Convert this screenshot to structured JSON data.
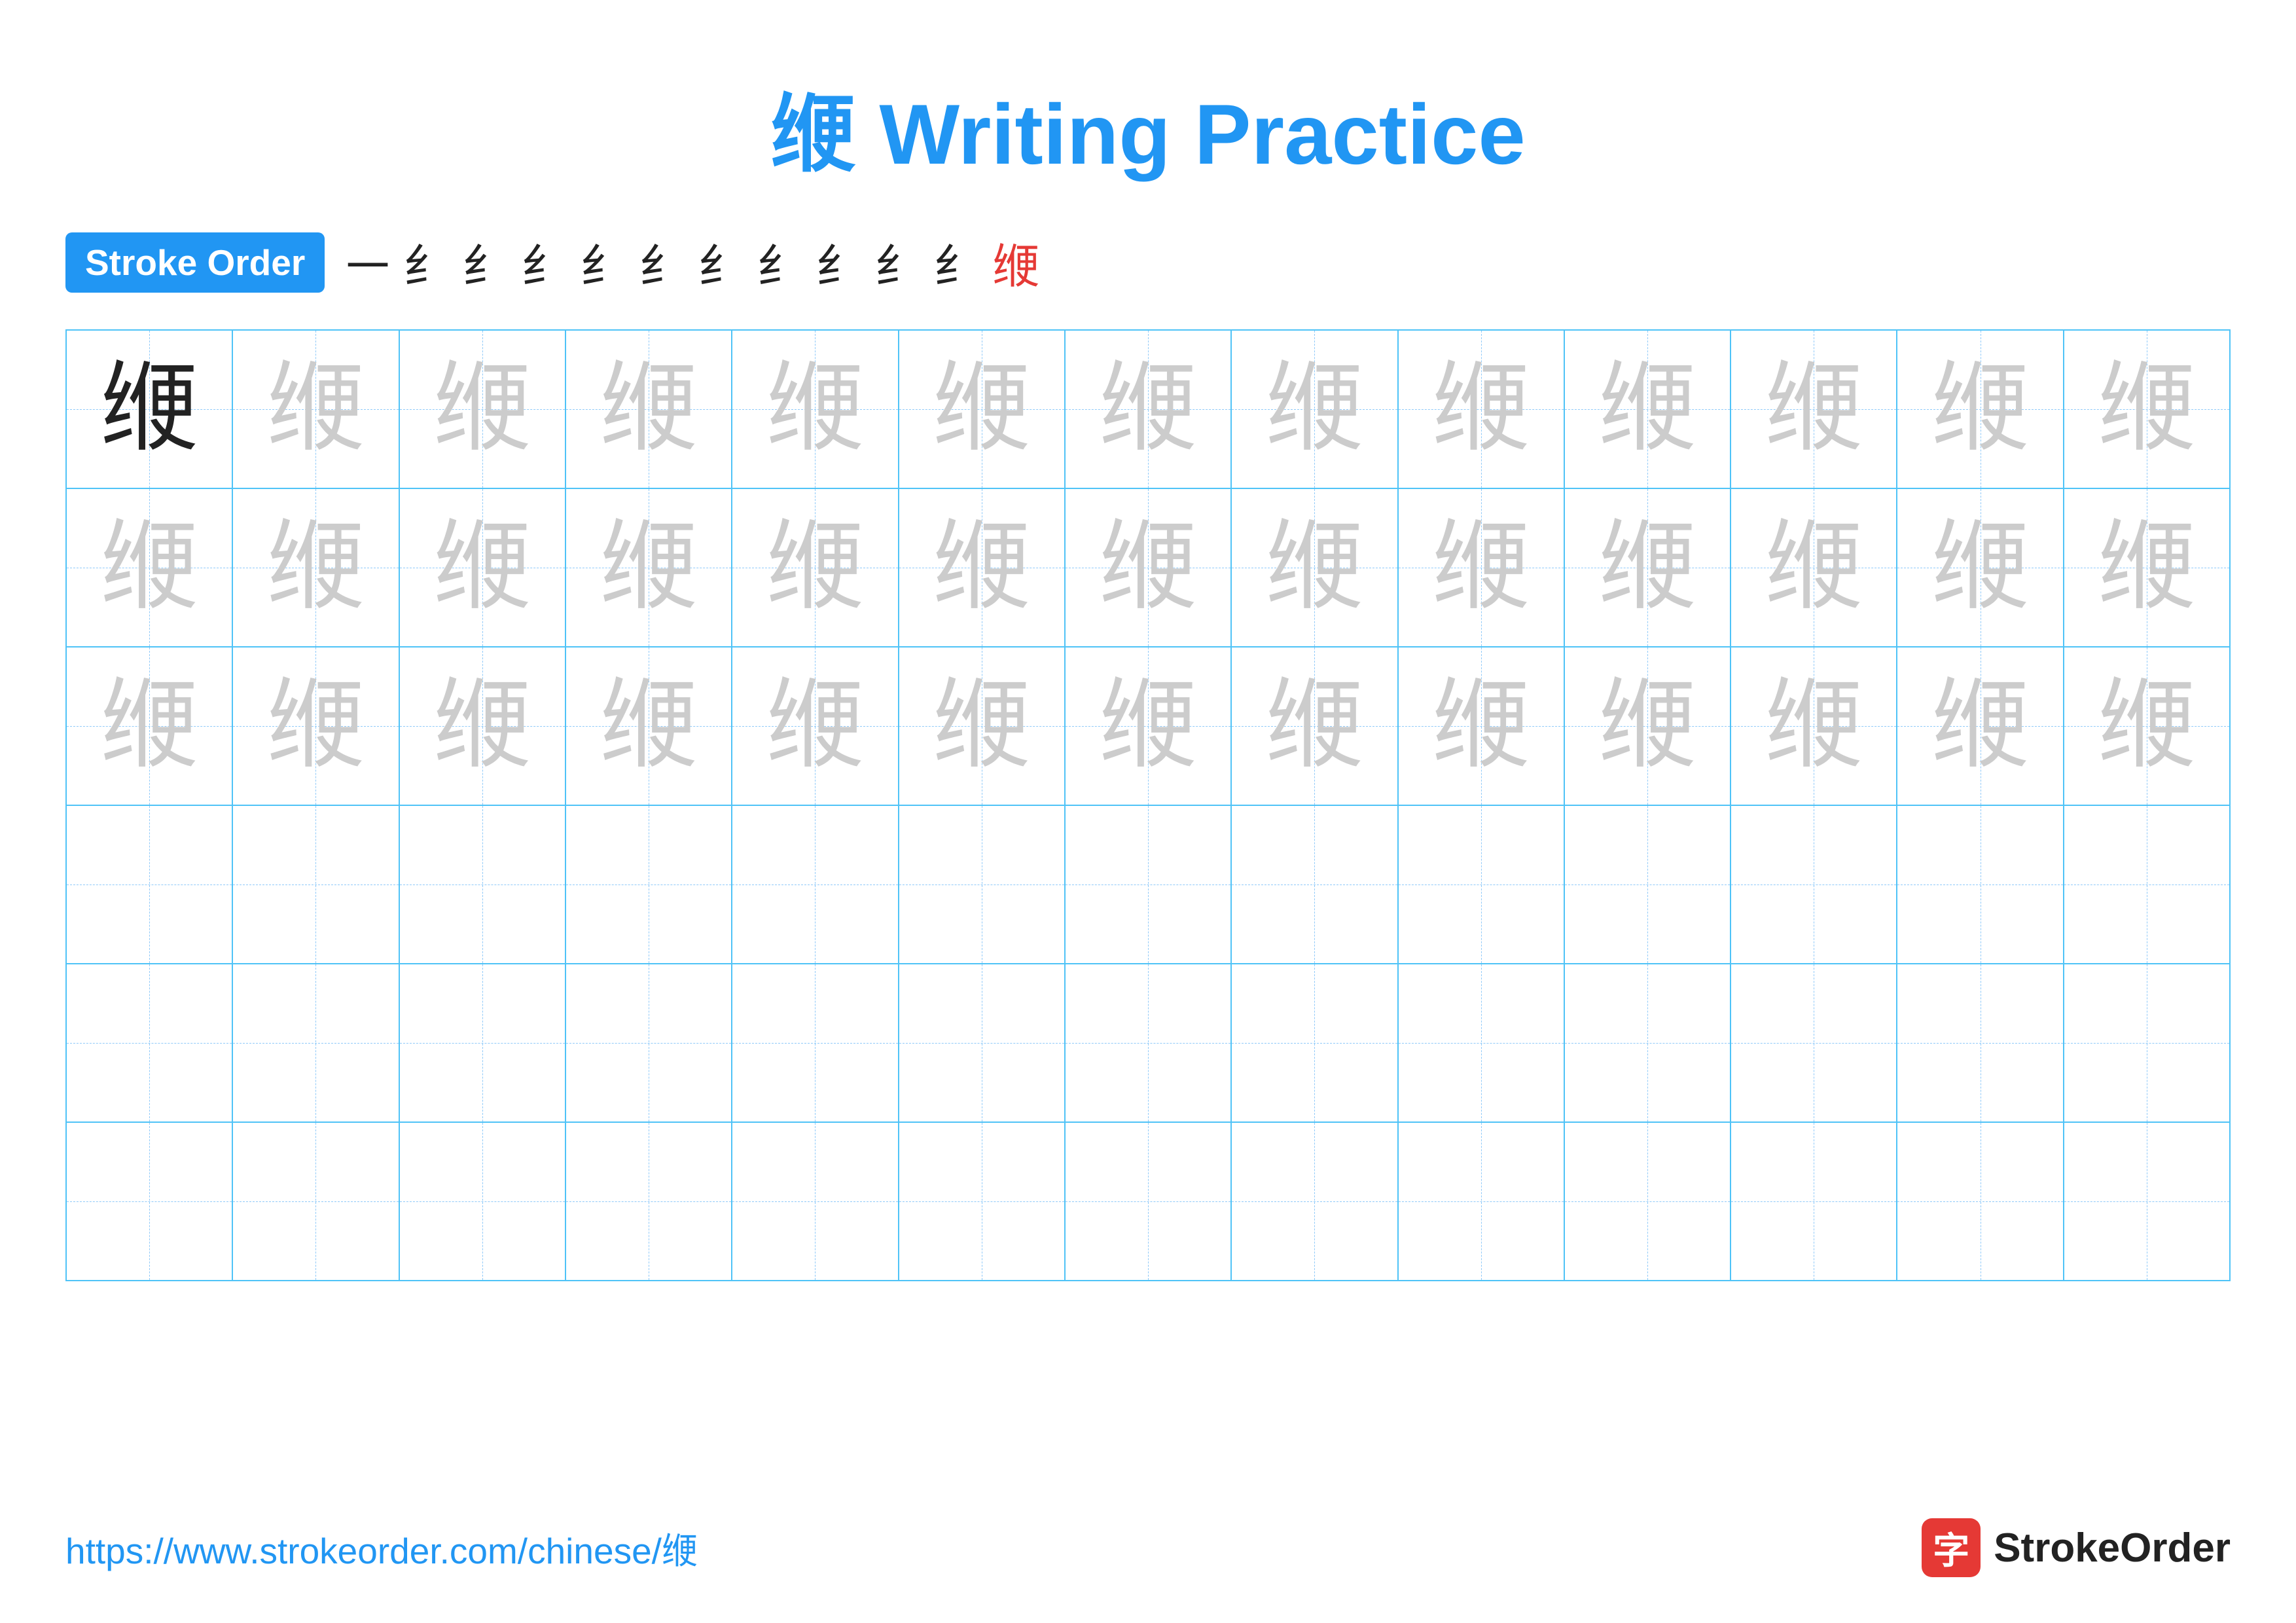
{
  "title": "缏 Writing Practice",
  "stroke_order_badge": "Stroke Order",
  "stroke_sequence": [
    "㇐",
    "纟",
    "纟",
    "纟",
    "纟",
    "纟",
    "纟",
    "纟",
    "纟",
    "纟",
    "纟",
    "缏"
  ],
  "character": "缏",
  "rows": [
    {
      "cells": [
        {
          "char": "缏",
          "style": "dark"
        },
        {
          "char": "缏",
          "style": "light"
        },
        {
          "char": "缏",
          "style": "light"
        },
        {
          "char": "缏",
          "style": "light"
        },
        {
          "char": "缏",
          "style": "light"
        },
        {
          "char": "缏",
          "style": "light"
        },
        {
          "char": "缏",
          "style": "light"
        },
        {
          "char": "缏",
          "style": "light"
        },
        {
          "char": "缏",
          "style": "light"
        },
        {
          "char": "缏",
          "style": "light"
        },
        {
          "char": "缏",
          "style": "light"
        },
        {
          "char": "缏",
          "style": "light"
        },
        {
          "char": "缏",
          "style": "light"
        }
      ]
    },
    {
      "cells": [
        {
          "char": "缏",
          "style": "light"
        },
        {
          "char": "缏",
          "style": "light"
        },
        {
          "char": "缏",
          "style": "light"
        },
        {
          "char": "缏",
          "style": "light"
        },
        {
          "char": "缏",
          "style": "light"
        },
        {
          "char": "缏",
          "style": "light"
        },
        {
          "char": "缏",
          "style": "light"
        },
        {
          "char": "缏",
          "style": "light"
        },
        {
          "char": "缏",
          "style": "light"
        },
        {
          "char": "缏",
          "style": "light"
        },
        {
          "char": "缏",
          "style": "light"
        },
        {
          "char": "缏",
          "style": "light"
        },
        {
          "char": "缏",
          "style": "light"
        }
      ]
    },
    {
      "cells": [
        {
          "char": "缏",
          "style": "light"
        },
        {
          "char": "缏",
          "style": "light"
        },
        {
          "char": "缏",
          "style": "light"
        },
        {
          "char": "缏",
          "style": "light"
        },
        {
          "char": "缏",
          "style": "light"
        },
        {
          "char": "缏",
          "style": "light"
        },
        {
          "char": "缏",
          "style": "light"
        },
        {
          "char": "缏",
          "style": "light"
        },
        {
          "char": "缏",
          "style": "light"
        },
        {
          "char": "缏",
          "style": "light"
        },
        {
          "char": "缏",
          "style": "light"
        },
        {
          "char": "缏",
          "style": "light"
        },
        {
          "char": "缏",
          "style": "light"
        }
      ]
    },
    {
      "cells": [
        {
          "char": "",
          "style": "empty"
        },
        {
          "char": "",
          "style": "empty"
        },
        {
          "char": "",
          "style": "empty"
        },
        {
          "char": "",
          "style": "empty"
        },
        {
          "char": "",
          "style": "empty"
        },
        {
          "char": "",
          "style": "empty"
        },
        {
          "char": "",
          "style": "empty"
        },
        {
          "char": "",
          "style": "empty"
        },
        {
          "char": "",
          "style": "empty"
        },
        {
          "char": "",
          "style": "empty"
        },
        {
          "char": "",
          "style": "empty"
        },
        {
          "char": "",
          "style": "empty"
        },
        {
          "char": "",
          "style": "empty"
        }
      ]
    },
    {
      "cells": [
        {
          "char": "",
          "style": "empty"
        },
        {
          "char": "",
          "style": "empty"
        },
        {
          "char": "",
          "style": "empty"
        },
        {
          "char": "",
          "style": "empty"
        },
        {
          "char": "",
          "style": "empty"
        },
        {
          "char": "",
          "style": "empty"
        },
        {
          "char": "",
          "style": "empty"
        },
        {
          "char": "",
          "style": "empty"
        },
        {
          "char": "",
          "style": "empty"
        },
        {
          "char": "",
          "style": "empty"
        },
        {
          "char": "",
          "style": "empty"
        },
        {
          "char": "",
          "style": "empty"
        },
        {
          "char": "",
          "style": "empty"
        }
      ]
    },
    {
      "cells": [
        {
          "char": "",
          "style": "empty"
        },
        {
          "char": "",
          "style": "empty"
        },
        {
          "char": "",
          "style": "empty"
        },
        {
          "char": "",
          "style": "empty"
        },
        {
          "char": "",
          "style": "empty"
        },
        {
          "char": "",
          "style": "empty"
        },
        {
          "char": "",
          "style": "empty"
        },
        {
          "char": "",
          "style": "empty"
        },
        {
          "char": "",
          "style": "empty"
        },
        {
          "char": "",
          "style": "empty"
        },
        {
          "char": "",
          "style": "empty"
        },
        {
          "char": "",
          "style": "empty"
        },
        {
          "char": "",
          "style": "empty"
        }
      ]
    }
  ],
  "footer": {
    "url": "https://www.strokeorder.com/chinese/缏",
    "logo_char": "字",
    "logo_text": "StrokeOrder"
  }
}
